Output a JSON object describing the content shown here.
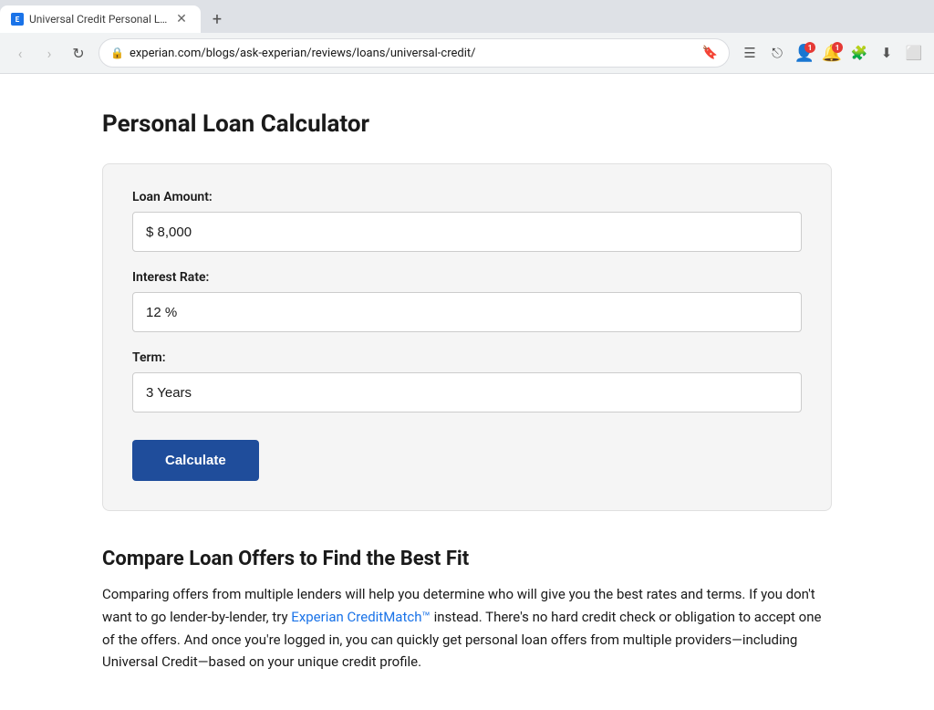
{
  "browser": {
    "tab": {
      "title": "Universal Credit Personal Loan Re",
      "favicon_letter": "E"
    },
    "new_tab_label": "+",
    "nav": {
      "back_label": "‹",
      "forward_label": "›",
      "reload_label": "↻"
    },
    "address": "experian.com/blogs/ask-experian/reviews/loans/universal-credit/",
    "icons": {
      "menu": "☰",
      "share": "⎋",
      "extensions": "🧩",
      "download": "⬇",
      "window": "⬜"
    }
  },
  "calculator": {
    "page_title": "Personal Loan Calculator",
    "card": {
      "loan_amount_label": "Loan Amount:",
      "loan_amount_value": "$ 8,000",
      "interest_rate_label": "Interest Rate:",
      "interest_rate_value": "12 %",
      "term_label": "Term:",
      "term_value": "3 Years",
      "calculate_button": "Calculate"
    },
    "compare_section": {
      "title": "Compare Loan Offers to Find the Best Fit",
      "text_before_link": "Comparing offers from multiple lenders will help you determine who will give you the best rates and terms. If you don't want to go lender-by-lender, try ",
      "link_text": "Experian CreditMatch™",
      "text_after_link": " instead. There's no hard credit check or obligation to accept one of the offers. And once you're logged in, you can quickly get personal loan offers from multiple providers—including Universal Credit—based on your unique credit profile."
    }
  }
}
